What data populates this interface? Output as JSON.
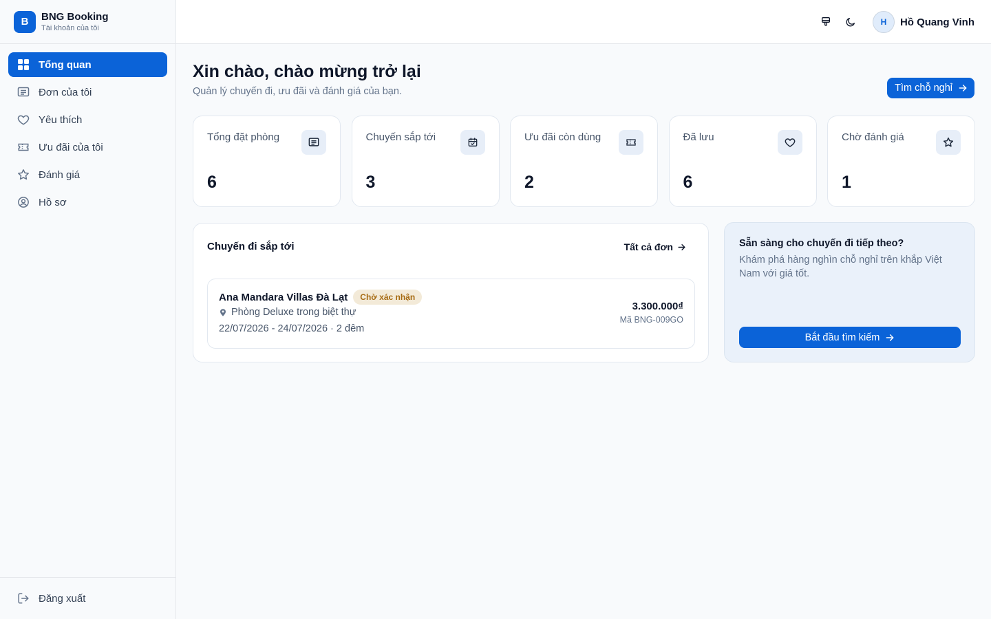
{
  "brand": {
    "logo_letter": "B",
    "name": "BNG Booking",
    "subtitle": "Tài khoản của tôi"
  },
  "sidebar": {
    "items": [
      {
        "label": "Tổng quan",
        "icon": "grid-icon",
        "active": true
      },
      {
        "label": "Đơn của tôi",
        "icon": "receipt-icon",
        "active": false
      },
      {
        "label": "Yêu thích",
        "icon": "heart-icon",
        "active": false
      },
      {
        "label": "Ưu đãi của tôi",
        "icon": "ticket-icon",
        "active": false
      },
      {
        "label": "Đánh giá",
        "icon": "star-icon",
        "active": false
      },
      {
        "label": "Hồ sơ",
        "icon": "user-circle-icon",
        "active": false
      }
    ],
    "logout_label": "Đăng xuất"
  },
  "topbar": {
    "icons": [
      "paint-brush-icon",
      "moon-icon"
    ],
    "avatar_initial": "H",
    "user_name": "Hồ Quang Vinh"
  },
  "main": {
    "title": "Xin chào, chào mừng trở lại",
    "subtitle": "Quản lý chuyến đi, ưu đãi và đánh giá của bạn.",
    "search_button": "Tìm chỗ nghỉ",
    "stats": [
      {
        "label": "Tổng đặt phòng",
        "value": "6",
        "icon": "receipt-icon"
      },
      {
        "label": "Chuyến sắp tới",
        "value": "3",
        "icon": "calendar-check-icon"
      },
      {
        "label": "Ưu đãi còn dùng",
        "value": "2",
        "icon": "ticket-icon"
      },
      {
        "label": "Đã lưu",
        "value": "6",
        "icon": "heart-icon"
      },
      {
        "label": "Chờ đánh giá",
        "value": "1",
        "icon": "star-icon"
      }
    ],
    "trips": {
      "title": "Chuyến đi sắp tới",
      "link_label": "Tất cả đơn",
      "booking": {
        "name": "Ana Mandara Villas Đà Lạt",
        "status": "Chờ xác nhận",
        "room": "Phòng Deluxe trong biệt thự",
        "dates": "22/07/2026 - 24/07/2026 · 2 đêm",
        "price": "3.300.000₫",
        "code": "Mã BNG-009GO"
      }
    },
    "promo": {
      "title": "Sẵn sàng cho chuyến đi tiếp theo?",
      "description": "Khám phá hàng nghìn chỗ nghỉ trên khắp Việt Nam với giá tốt.",
      "button": "Bắt đầu tìm kiếm"
    }
  },
  "colors": {
    "primary": "#0b63d8",
    "badge_bg": "#f3ead8",
    "badge_text": "#a66a12",
    "panel_bg": "#f8fafc"
  }
}
